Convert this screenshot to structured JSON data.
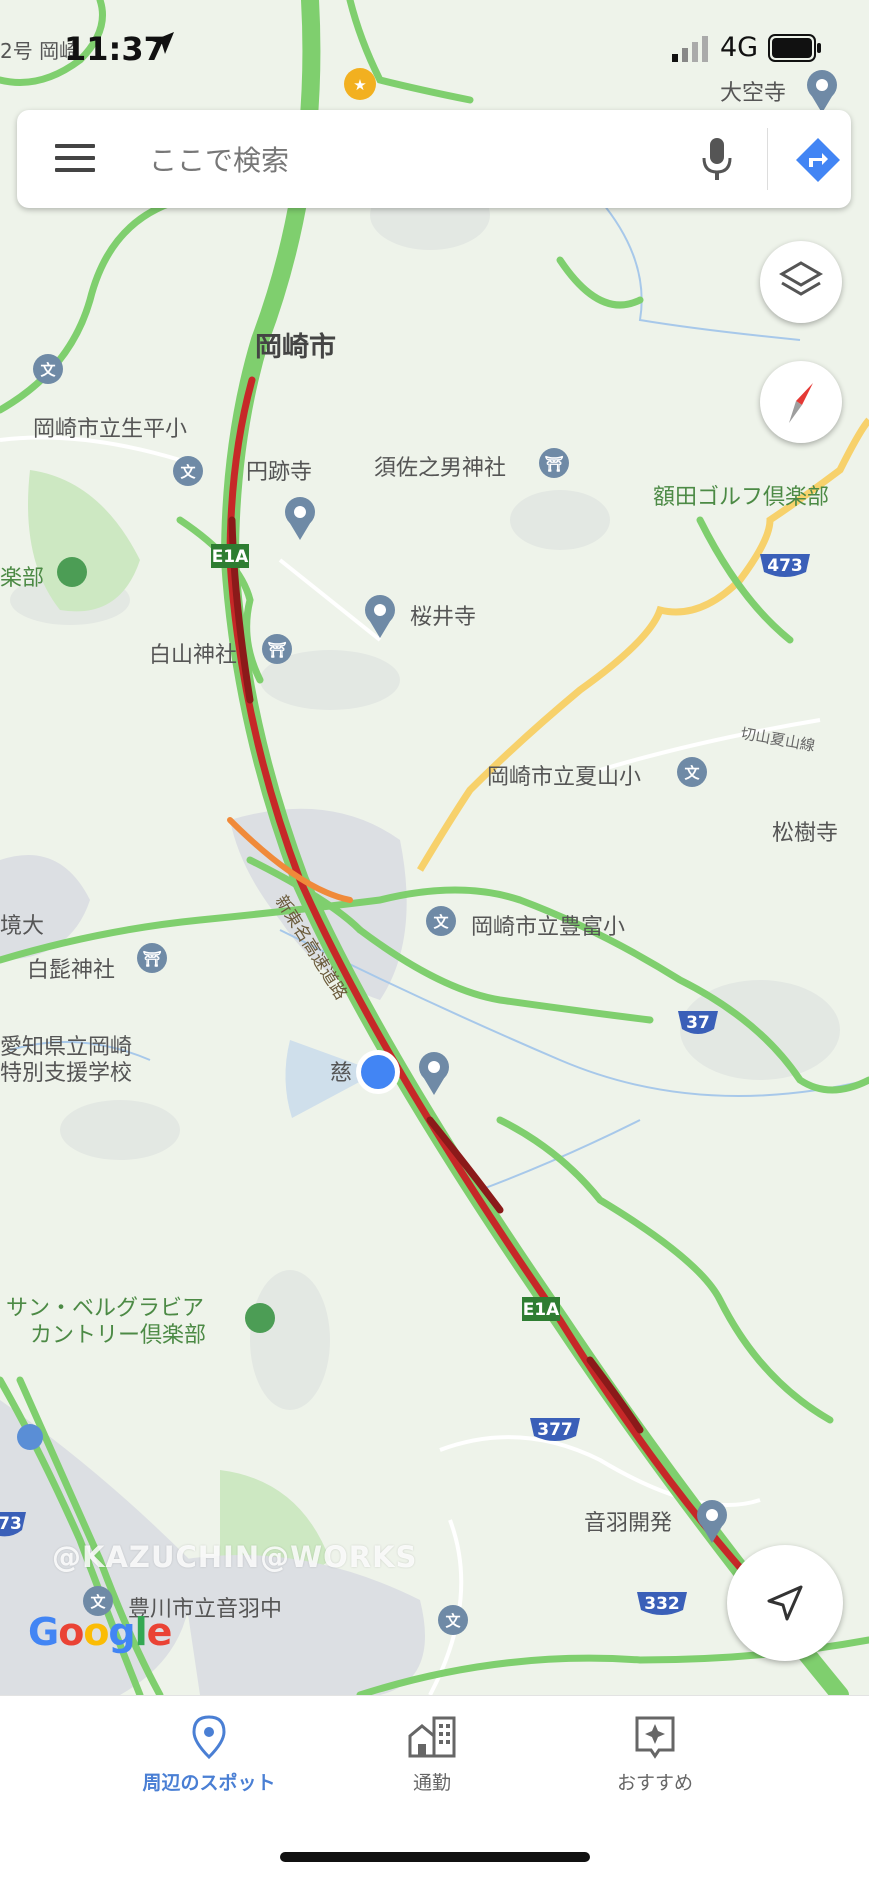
{
  "status_bar": {
    "time": "11:37",
    "network": "4G"
  },
  "search": {
    "placeholder": "ここで検索"
  },
  "map": {
    "labels": {
      "city": "岡崎市",
      "school_ikuhira": "岡崎市立生平小",
      "enseki_ji": "円跡寺",
      "susanoo": "須佐之男神社",
      "nukata_golf": "額田ゴルフ倶楽部",
      "club_left": "楽部",
      "sakurai_ji": "桜井寺",
      "hakusan": "白山神社",
      "natsuyama_school": "岡崎市立夏山小",
      "kiriyama_road": "切山夏山線",
      "shoju_ji": "松樹寺",
      "expressway": "新東名高速道路",
      "toyotomi_school": "岡崎市立豊富小",
      "kyo_oh": "境大",
      "hakuhige": "白髭神社",
      "aichi_school_1": "愛知県立岡崎",
      "aichi_school_2": "特別支援学校",
      "jiun_partial": "慈",
      "golf_sun_1": "サン・ベルグラビア",
      "golf_sun_2": "カントリー倶楽部",
      "otowa_kaihatsu": "音羽開発",
      "otowa_school": "豊川市立音羽中",
      "daikuji": "大空寺",
      "route_top_left": "2号 岡崎"
    },
    "shields": {
      "e1a_north": "E1A",
      "e1a_south": "E1A",
      "r473": "473",
      "r37": "37",
      "r377": "377",
      "r332": "332",
      "r473_left": "73"
    }
  },
  "watermark": "@KAZUCHIN@WORKS",
  "logo": [
    "G",
    "o",
    "o",
    "g",
    "l",
    "e"
  ],
  "bottom_nav": {
    "items": [
      {
        "label": "周辺のスポット"
      },
      {
        "label": "通勤"
      },
      {
        "label": "おすすめ"
      }
    ]
  },
  "colors": {
    "accent": "#4285F4",
    "traffic_red": "#c62828",
    "traffic_dark": "#8b1a1a",
    "traffic_orange": "#f08a3a",
    "road_green": "#7fcf6e",
    "road_yellow": "#f7d16b",
    "place_pin": "#5f7f9f"
  }
}
